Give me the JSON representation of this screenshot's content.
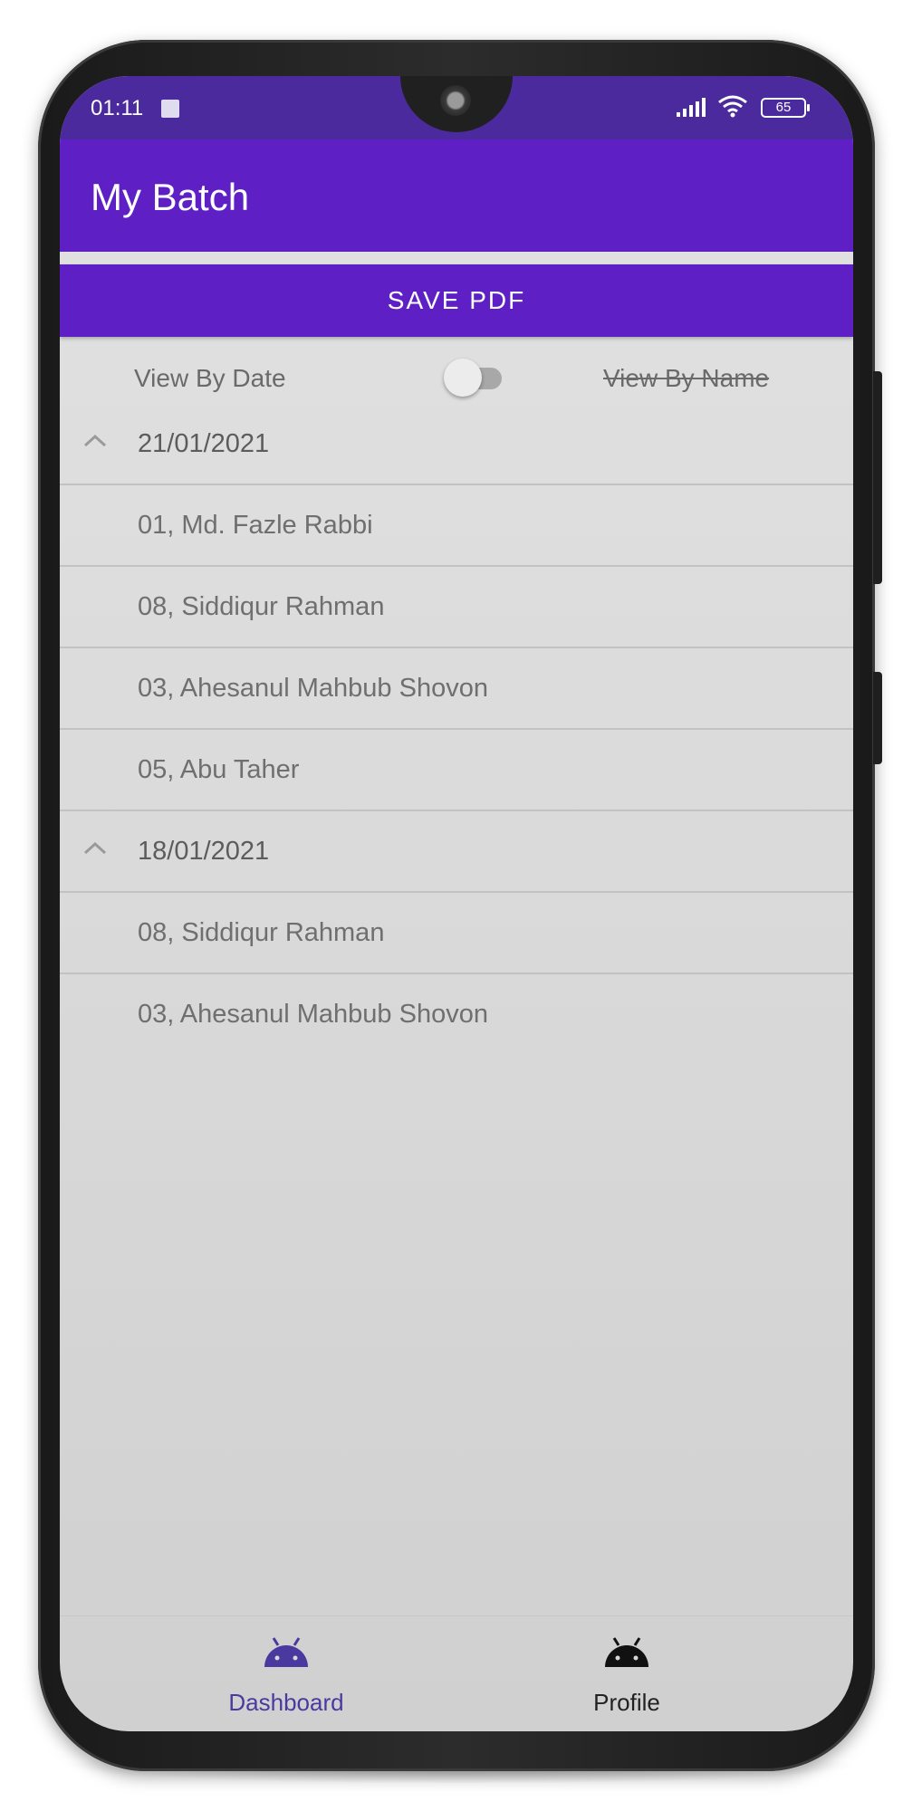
{
  "status_bar": {
    "time": "01:11",
    "battery": "65"
  },
  "app_bar": {
    "title": "My Batch"
  },
  "actions": {
    "save_pdf_label": "SAVE PDF"
  },
  "view_toggle": {
    "left_label": "View By Date",
    "right_label": "View By Name",
    "enabled": false
  },
  "groups": [
    {
      "date": "21/01/2021",
      "entries": [
        "01, Md. Fazle Rabbi",
        "08, Siddiqur Rahman",
        "03, Ahesanul Mahbub Shovon",
        "05, Abu Taher"
      ]
    },
    {
      "date": "18/01/2021",
      "entries": [
        "08, Siddiqur Rahman",
        "03, Ahesanul Mahbub Shovon"
      ]
    }
  ],
  "bottom_nav": {
    "items": [
      {
        "label": "Dashboard",
        "icon": "android-icon",
        "active": true
      },
      {
        "label": "Profile",
        "icon": "android-icon",
        "active": false
      }
    ]
  },
  "colors": {
    "primary": "#5e20c4",
    "status_bar": "#4a2a9c",
    "nav_active": "#4a3aa0"
  }
}
